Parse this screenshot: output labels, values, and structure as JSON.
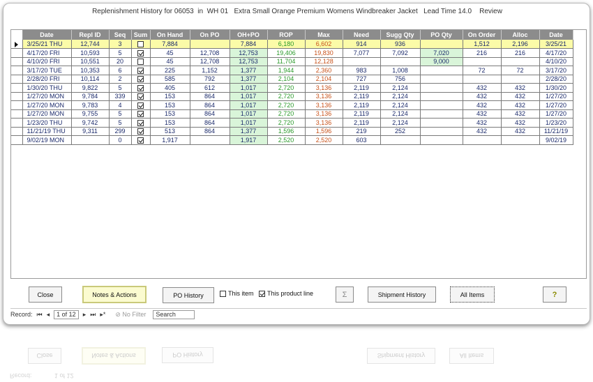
{
  "title": "Replenishment History for 06053  in  WH 01   Extra Small Orange Premium Womens Windbreaker Jacket   Lead Time 14.0    Review",
  "columns": [
    "Date",
    "Repl ID",
    "Seq",
    "Sum",
    "On Hand",
    "On PO",
    "OH+PO",
    "ROP",
    "Max",
    "Need",
    "Sugg Qty",
    "PO Qty",
    "On Order",
    "Alloc",
    "Date"
  ],
  "rows": [
    {
      "date": "3/25/21  THU",
      "repl": "12,744",
      "seq": "3",
      "sum": false,
      "onhand": "7,884",
      "onpo": "",
      "ohpo": "7,884",
      "rop": "6,180",
      "max": "6,602",
      "need": "914",
      "sugg": "936",
      "poqty": "",
      "onorder": "1,512",
      "alloc": "2,196",
      "date2": "3/25/21"
    },
    {
      "date": "4/17/20  FRI",
      "repl": "10,593",
      "seq": "5",
      "sum": true,
      "onhand": "45",
      "onpo": "12,708",
      "ohpo": "12,753",
      "rop": "19,406",
      "max": "19,830",
      "need": "7,077",
      "sugg": "7,092",
      "poqty": "7,020",
      "onorder": "216",
      "alloc": "216",
      "date2": "4/17/20"
    },
    {
      "date": "4/10/20  FRI",
      "repl": "10,551",
      "seq": "20",
      "sum": false,
      "onhand": "45",
      "onpo": "12,708",
      "ohpo": "12,753",
      "rop": "11,704",
      "max": "12,128",
      "need": "",
      "sugg": "",
      "poqty": "9,000",
      "onorder": "",
      "alloc": "",
      "date2": "4/10/20"
    },
    {
      "date": "3/17/20  TUE",
      "repl": "10,353",
      "seq": "6",
      "sum": true,
      "onhand": "225",
      "onpo": "1,152",
      "ohpo": "1,377",
      "rop": "1,944",
      "max": "2,360",
      "need": "983",
      "sugg": "1,008",
      "poqty": "",
      "onorder": "72",
      "alloc": "72",
      "date2": "3/17/20"
    },
    {
      "date": "2/28/20  FRI",
      "repl": "10,114",
      "seq": "2",
      "sum": true,
      "onhand": "585",
      "onpo": "792",
      "ohpo": "1,377",
      "rop": "2,104",
      "max": "2,104",
      "need": "727",
      "sugg": "756",
      "poqty": "",
      "onorder": "",
      "alloc": "",
      "date2": "2/28/20"
    },
    {
      "date": "1/30/20  THU",
      "repl": "9,822",
      "seq": "5",
      "sum": true,
      "onhand": "405",
      "onpo": "612",
      "ohpo": "1,017",
      "rop": "2,720",
      "max": "3,136",
      "need": "2,119",
      "sugg": "2,124",
      "poqty": "",
      "onorder": "432",
      "alloc": "432",
      "date2": "1/30/20"
    },
    {
      "date": "1/27/20  MON",
      "repl": "9,784",
      "seq": "339",
      "sum": true,
      "onhand": "153",
      "onpo": "864",
      "ohpo": "1,017",
      "rop": "2,720",
      "max": "3,136",
      "need": "2,119",
      "sugg": "2,124",
      "poqty": "",
      "onorder": "432",
      "alloc": "432",
      "date2": "1/27/20"
    },
    {
      "date": "1/27/20  MON",
      "repl": "9,783",
      "seq": "4",
      "sum": true,
      "onhand": "153",
      "onpo": "864",
      "ohpo": "1,017",
      "rop": "2,720",
      "max": "3,136",
      "need": "2,119",
      "sugg": "2,124",
      "poqty": "",
      "onorder": "432",
      "alloc": "432",
      "date2": "1/27/20"
    },
    {
      "date": "1/27/20  MON",
      "repl": "9,755",
      "seq": "5",
      "sum": true,
      "onhand": "153",
      "onpo": "864",
      "ohpo": "1,017",
      "rop": "2,720",
      "max": "3,136",
      "need": "2,119",
      "sugg": "2,124",
      "poqty": "",
      "onorder": "432",
      "alloc": "432",
      "date2": "1/27/20"
    },
    {
      "date": "1/23/20  THU",
      "repl": "9,742",
      "seq": "5",
      "sum": true,
      "onhand": "153",
      "onpo": "864",
      "ohpo": "1,017",
      "rop": "2,720",
      "max": "3,136",
      "need": "2,119",
      "sugg": "2,124",
      "poqty": "",
      "onorder": "432",
      "alloc": "432",
      "date2": "1/23/20"
    },
    {
      "date": "11/21/19  THU",
      "repl": "9,311",
      "seq": "299",
      "sum": true,
      "onhand": "513",
      "onpo": "864",
      "ohpo": "1,377",
      "rop": "1,596",
      "max": "1,596",
      "need": "219",
      "sugg": "252",
      "poqty": "",
      "onorder": "432",
      "alloc": "432",
      "date2": "11/21/19"
    },
    {
      "date": "9/02/19  MON",
      "repl": "",
      "seq": "0",
      "sum": true,
      "onhand": "1,917",
      "onpo": "",
      "ohpo": "1,917",
      "rop": "2,520",
      "max": "2,520",
      "need": "603",
      "sugg": "",
      "poqty": "",
      "onorder": "",
      "alloc": "",
      "date2": "9/02/19"
    }
  ],
  "buttons": {
    "close": "Close",
    "notes": "Notes & Actions",
    "po_history": "PO History",
    "this_item": "This item",
    "this_product_line": "This product line",
    "sigma": "Σ",
    "shipment_history": "Shipment History",
    "all_items": "All Items",
    "help": "?"
  },
  "checkboxes": {
    "this_item": false,
    "this_product_line": true
  },
  "status": {
    "record_label": "Record:",
    "first": "⏮",
    "prev": "◂",
    "record_value": "1 of 12",
    "next": "▸",
    "last": "⏭",
    "new": "▸*",
    "filter": "No Filter",
    "search": "Search"
  },
  "colors": {
    "header": "#8c8c8c",
    "current_row": "#fbfba8",
    "ohpo_fill": "#d9f5d9",
    "rop_text": "#2a9a2a",
    "max_text": "#c8521a"
  }
}
